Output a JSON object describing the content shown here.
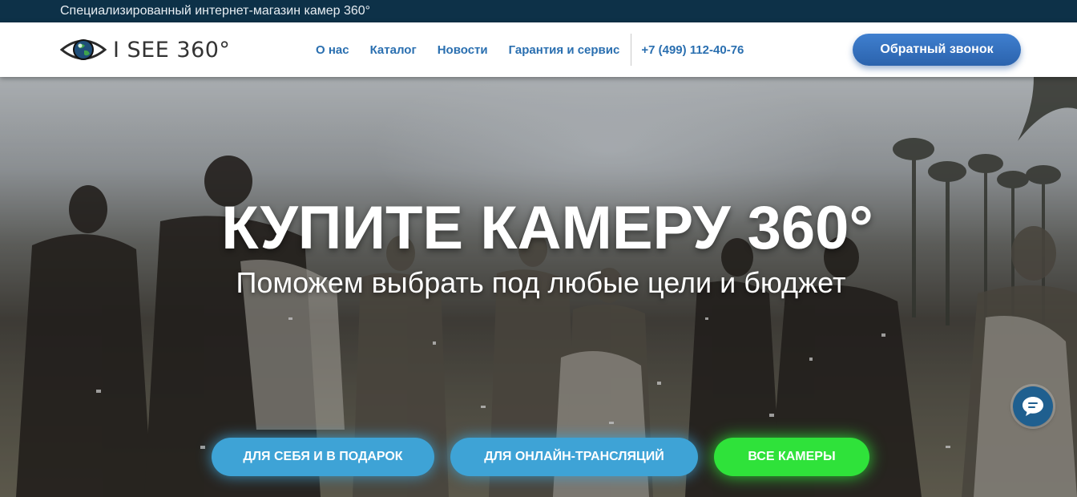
{
  "topbar": {
    "text": "Специализированный интернет-магазин камер 360°"
  },
  "header": {
    "logo_text": "I SEE 360°",
    "nav": [
      {
        "label": "О нас"
      },
      {
        "label": "Каталог"
      },
      {
        "label": "Новости"
      },
      {
        "label": "Гарантия и сервис"
      }
    ],
    "phone": "+7 (499) 112-40-76",
    "callback_label": "Обратный звонок"
  },
  "hero": {
    "title": "КУПИТЕ КАМЕРУ 360°",
    "subtitle": "Поможем выбрать под любые цели и бюджет",
    "buttons": [
      {
        "label": "ДЛЯ СЕБЯ И В ПОДАРОК",
        "color": "#3ea3d6"
      },
      {
        "label": "ДЛЯ ОНЛАЙН-ТРАНСЛЯЦИЙ",
        "color": "#3ea3d6"
      },
      {
        "label": "ВСЕ КАМЕРЫ",
        "color": "#2fe23a"
      }
    ]
  },
  "chat": {
    "icon": "chat-bubble-icon"
  },
  "colors": {
    "topbar_bg": "#0d3148",
    "nav_link": "#2a6fb0",
    "accent_blue": "#2b63ad",
    "accent_green": "#2fe23a"
  }
}
